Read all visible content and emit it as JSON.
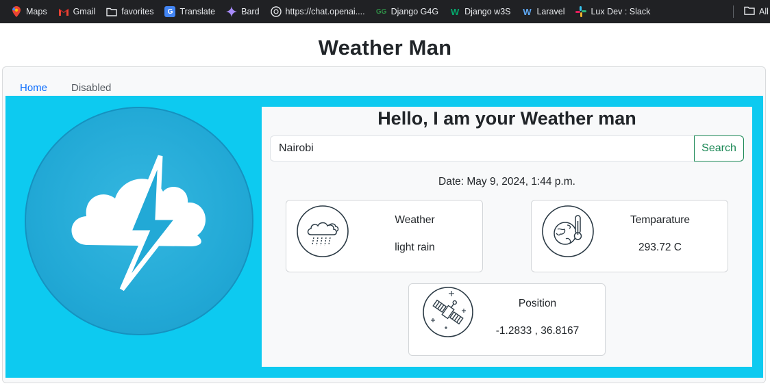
{
  "bookmarks": {
    "items": [
      {
        "label": "Maps",
        "icon": "maps-pin-icon"
      },
      {
        "label": "Gmail",
        "icon": "gmail-icon"
      },
      {
        "label": "favorites",
        "icon": "folder-icon"
      },
      {
        "label": "Translate",
        "icon": "translate-icon"
      },
      {
        "label": "Bard",
        "icon": "bard-sparkle-icon"
      },
      {
        "label": "https://chat.openai....",
        "icon": "openai-icon"
      },
      {
        "label": "Django G4G",
        "icon": "g4g-icon"
      },
      {
        "label": "Django w3S",
        "icon": "w3s-icon"
      },
      {
        "label": "Laravel",
        "icon": "laravel-icon"
      },
      {
        "label": "Lux Dev : Slack",
        "icon": "slack-icon"
      }
    ],
    "all_label": "All"
  },
  "page": {
    "title": "Weather Man"
  },
  "nav": {
    "home": "Home",
    "disabled": "Disabled"
  },
  "panel": {
    "heading": "Hello, I am your Weather man",
    "search_value": "Nairobi",
    "search_button": "Search",
    "date": "Date: May 9, 2024, 1:44 p.m."
  },
  "cards": {
    "weather": {
      "label": "Weather",
      "value": "light rain",
      "icon": "cloud-rain-icon"
    },
    "temperature": {
      "label": "Temparature",
      "value": "293.72 C",
      "icon": "globe-thermometer-icon"
    },
    "position": {
      "label": "Position",
      "value": "-1.2833 , 36.8167",
      "icon": "satellite-icon"
    }
  },
  "colors": {
    "hero_bg": "#0dcaf0",
    "logo_circle": "#22a9d6",
    "link": "#0d6efd",
    "search_button": "#198754",
    "bookmarks_bar": "#202124"
  }
}
